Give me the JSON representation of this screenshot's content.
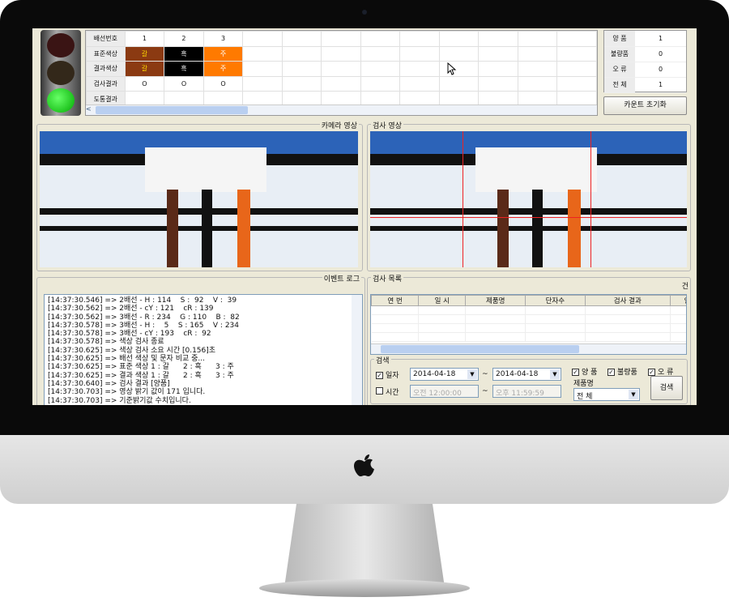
{
  "traffic_light": {
    "state": "green"
  },
  "wire_grid": {
    "row_labels": [
      "배선번호",
      "표준색상",
      "결과색상",
      "검사결과",
      "도통결과"
    ],
    "columns": [
      "1",
      "2",
      "3"
    ],
    "standard": [
      {
        "t": "갈",
        "bg": "#8b3a12",
        "fg": "#ffd800"
      },
      {
        "t": "흑",
        "bg": "#000000",
        "fg": "#ffffff"
      },
      {
        "t": "주",
        "bg": "#ff7a00",
        "fg": "#ffffff"
      }
    ],
    "result": [
      {
        "t": "갈",
        "bg": "#8b3a12",
        "fg": "#ffd800"
      },
      {
        "t": "흑",
        "bg": "#000000",
        "fg": "#ffffff"
      },
      {
        "t": "주",
        "bg": "#ff7a00",
        "fg": "#ffffff"
      }
    ],
    "inspection": [
      "O",
      "O",
      "O"
    ]
  },
  "counts": {
    "rows": [
      {
        "label": "양  품",
        "value": "1"
      },
      {
        "label": "불량품",
        "value": "0"
      },
      {
        "label": "오  류",
        "value": "0"
      },
      {
        "label": "전  체",
        "value": "1"
      }
    ],
    "reset_label": "카운트 초기화"
  },
  "camera": {
    "label": "카메라 영상"
  },
  "inspect_image": {
    "label": "검사 영상"
  },
  "event_log": {
    "label": "이벤트 로그",
    "lines": [
      "[14:37:30.546] => 2배선 - H : 114    S :  92    V :  39",
      "[14:37:30.562] => 2배선 - cY : 121    cR : 139",
      "[14:37:30.562] => 3배선 - R : 234    G : 110    B :  82",
      "[14:37:30.578] => 3배선 - H :    5    S : 165    V : 234",
      "[14:37:30.578] => 3배선 - cY : 193    cR :  92",
      "[14:37:30.578] => 색상 검사 종료",
      "[14:37:30.625] => 색상 검사 소요 시간 [0.156]초",
      "[14:37:30.625] => 배선 색상 및 문자 비교 중...",
      "[14:37:30.625] => 표준 색상 1 : 갈      2 : 흑      3 : 주",
      "[14:37:30.625] => 결과 색상 1 : 갈      2 : 흑      3 : 주",
      "[14:37:30.640] => 검사 결과 [양품]",
      "[14:37:30.703] => 영상 밝기 값이 171 입니다.",
      "[14:37:30.703] => 기준밝기값 수치입니다."
    ]
  },
  "inspection_list": {
    "label": "검사 목록",
    "count_suffix": "건",
    "headers": [
      "연  번",
      "일  시",
      "제품명",
      "단자수",
      "검사 결과",
      "인쇄"
    ]
  },
  "search": {
    "label": "검색",
    "date_label": "일자",
    "date_from": "2014-04-18",
    "date_to": "2014-04-18",
    "time_label": "시간",
    "time_from": "오전 12:00:00",
    "time_to": "오후 11:59:59",
    "tilde": "~",
    "good": "양 품",
    "bad": "불량품",
    "error": "오 류",
    "product_label": "제품명",
    "product_value": "전    체",
    "search_button": "검색"
  }
}
